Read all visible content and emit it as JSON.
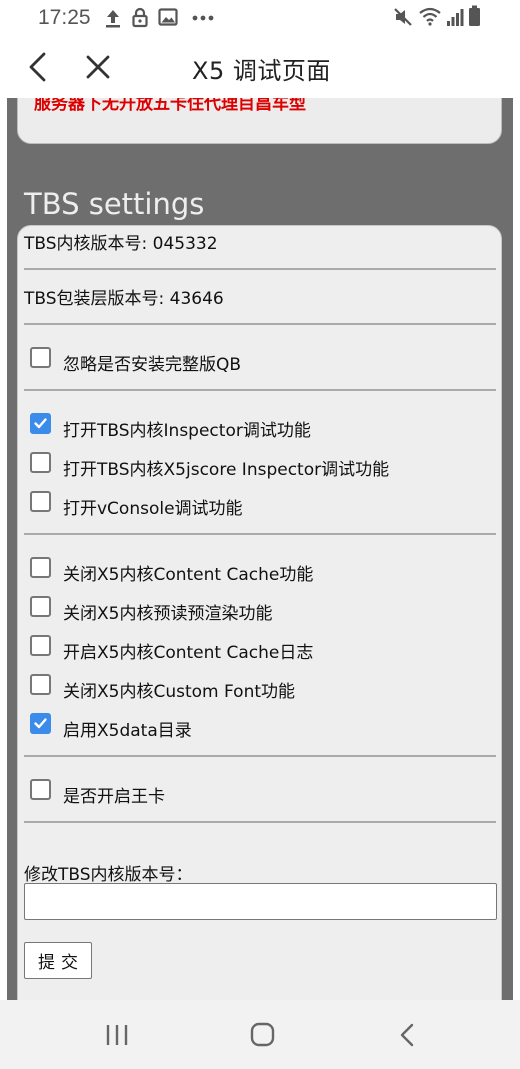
{
  "status_bar": {
    "time": "17:25",
    "left_icons": [
      "upload-icon",
      "lock-icon",
      "image-icon",
      "more-dots-icon"
    ],
    "right_icons": [
      "mute-icon",
      "wifi-icon",
      "signal-icon",
      "battery-icon"
    ]
  },
  "title_bar": {
    "title": "X5 调试页面",
    "back_icon": "chevron-left-icon",
    "close_icon": "close-icon"
  },
  "top_card": {
    "text": "服务器下无开放五卡住代理目昌车型"
  },
  "tbs": {
    "heading": "TBS settings",
    "core_version": "TBS内核版本号: 045332",
    "package_version": "TBS包装层版本号: 43646",
    "options": [
      {
        "label": "忽略是否安装完整版QB",
        "checked": false
      },
      {
        "label": "打开TBS内核Inspector调试功能",
        "checked": true
      },
      {
        "label": "打开TBS内核X5jscore Inspector调试功能",
        "checked": false
      },
      {
        "label": "打开vConsole调试功能",
        "checked": false
      },
      {
        "label": "关闭X5内核Content Cache功能",
        "checked": false
      },
      {
        "label": "关闭X5内核预读预渲染功能",
        "checked": false
      },
      {
        "label": "开启X5内核Content Cache日志",
        "checked": false
      },
      {
        "label": "关闭X5内核Custom Font功能",
        "checked": false
      },
      {
        "label": "启用X5data目录",
        "checked": true
      },
      {
        "label": "是否开启王卡",
        "checked": false
      }
    ],
    "version_input_label": "修改TBS内核版本号：",
    "version_input_value": "",
    "submit_label": "提交"
  },
  "nav_bar": {
    "icons": [
      "recent-apps-icon",
      "home-icon",
      "back-icon"
    ]
  },
  "colors": {
    "checkbox_checked": "#3b8beb",
    "frame_grey": "#6e6e6e",
    "card_bg": "#eeeeee",
    "alert_red": "#dd0000"
  }
}
